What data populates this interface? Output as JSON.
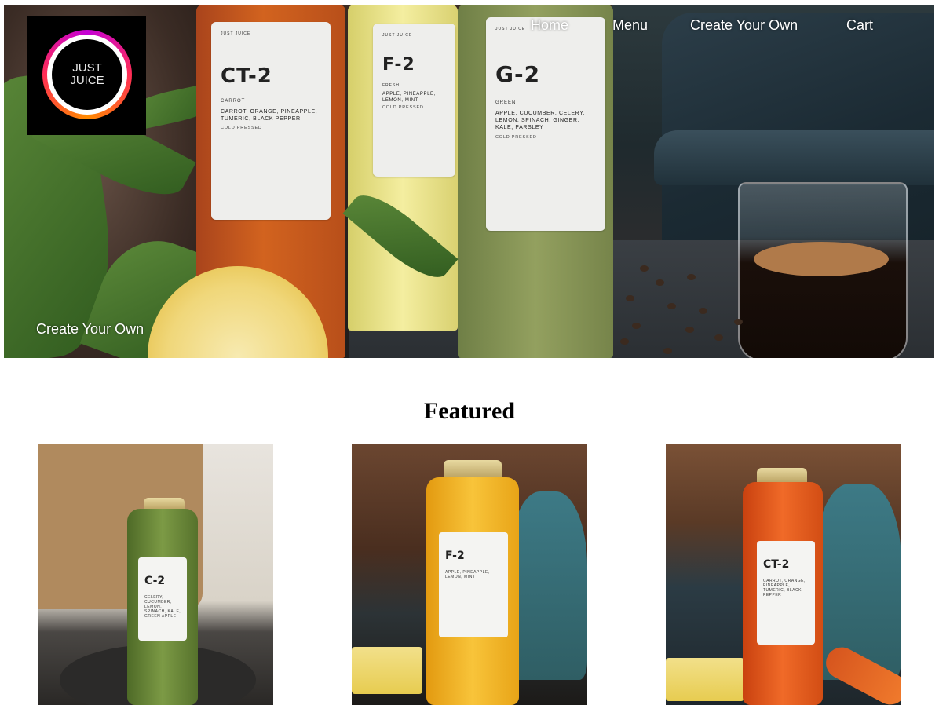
{
  "logo": {
    "line1": "JUST",
    "line2": "JUICE"
  },
  "nav": {
    "home": "Home",
    "menu": "Menu",
    "create": "Create Your Own",
    "cart": "Cart"
  },
  "hero": {
    "cta": "Create Your Own",
    "bottles": [
      {
        "brand": "JUST JUICE",
        "code": "CT-2",
        "kind": "CARROT",
        "ingredients": "CARROT, ORANGE, PINEAPPLE, TUMERIC, BLACK PEPPER",
        "note": "COLD PRESSED"
      },
      {
        "brand": "JUST JUICE",
        "code": "F-2",
        "kind": "FRESH",
        "ingredients": "APPLE, PINEAPPLE, LEMON, MINT",
        "note": "COLD PRESSED"
      },
      {
        "brand": "JUST JUICE",
        "code": "G-2",
        "kind": "GREEN",
        "ingredients": "APPLE, CUCUMBER, CELERY, LEMON, SPINACH, GINGER, KALE, PARSLEY",
        "note": "COLD PRESSED"
      }
    ]
  },
  "featured": {
    "title": "Featured",
    "items": [
      {
        "code": "C-2",
        "ingredients": "CELERY, CUCUMBER, LEMON, SPINACH, KALE, GREEN APPLE",
        "color": "#6f8a3a"
      },
      {
        "code": "F-2",
        "ingredients": "APPLE, PINEAPPLE, LEMON, MINT",
        "color": "#f2b21e"
      },
      {
        "code": "CT-2",
        "ingredients": "CARROT, ORANGE, PINEAPPLE, TUMERIC, BLACK PEPPER",
        "color": "#e2541c"
      }
    ]
  },
  "colors": {
    "background": "#ffffff",
    "nav_text": "#ffffff",
    "heading": "#000000"
  }
}
